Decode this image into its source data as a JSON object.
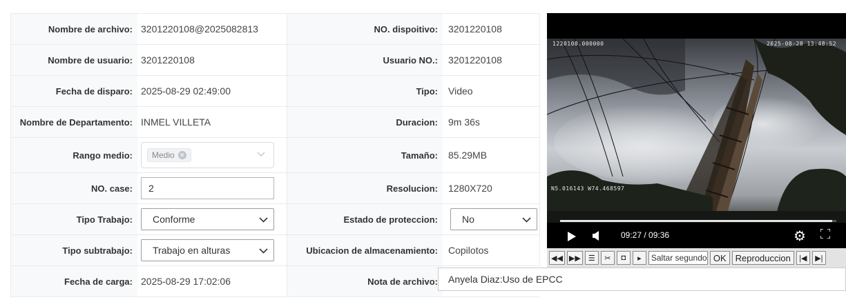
{
  "rows": [
    {
      "l1": "Nombre de archivo:",
      "v1": "3201220108@2025082813",
      "l2": "NO. dispoitivo:",
      "v2": "3201220108"
    },
    {
      "l1": "Nombre de usuario:",
      "v1": "3201220108",
      "l2": "Usuario NO.:",
      "v2": "3201220108"
    },
    {
      "l1": "Fecha de disparo:",
      "v1": "2025-08-29 02:49:00",
      "l2": "Tipo:",
      "v2": "Video"
    },
    {
      "l1": "Nombre de Departamento:",
      "v1": "INMEL VILLETA",
      "l2": "Duracion:",
      "v2": "9m 36s"
    },
    {
      "l1": "Rango medio:",
      "v1_tag": "Medio",
      "l2": "Tamaño:",
      "v2": "85.29MB"
    },
    {
      "l1": "NO. case:",
      "v1_input": "2",
      "l2": "Resolucion:",
      "v2": "1280X720"
    },
    {
      "l1": "Tipo Trabajo:",
      "v1_select": "Conforme",
      "l2": "Estado de proteccion:",
      "v2_select": "No"
    },
    {
      "l1": "Tipo subtrabajo:",
      "v1_select": "Trabajo en alturas",
      "l2": "Ubicacion de almacenamiento:",
      "v2": "Copilotos"
    },
    {
      "l1": "Fecha de carga:",
      "v1": "2025-08-29 17:02:06",
      "l2": "Nota de archivo:",
      "v2_note": "Anyela Diaz:Uso de EPCC"
    }
  ],
  "video": {
    "osd_top_left": "1220108.000000",
    "osd_top_right": "2025-08-28 13:48:52",
    "osd_gps": "N5.016143 W74.468597",
    "time": "09:27 / 09:36",
    "progress": 0.984
  },
  "toolbar": {
    "seek_placeholder": "Saltar segundo",
    "ok_label": "OK",
    "playback_label": "Reproduccion",
    "icons": [
      "rewind-icon",
      "fast-forward-icon",
      "list-icon",
      "scissors-icon",
      "prev-frame-icon",
      "next-frame-icon"
    ]
  }
}
